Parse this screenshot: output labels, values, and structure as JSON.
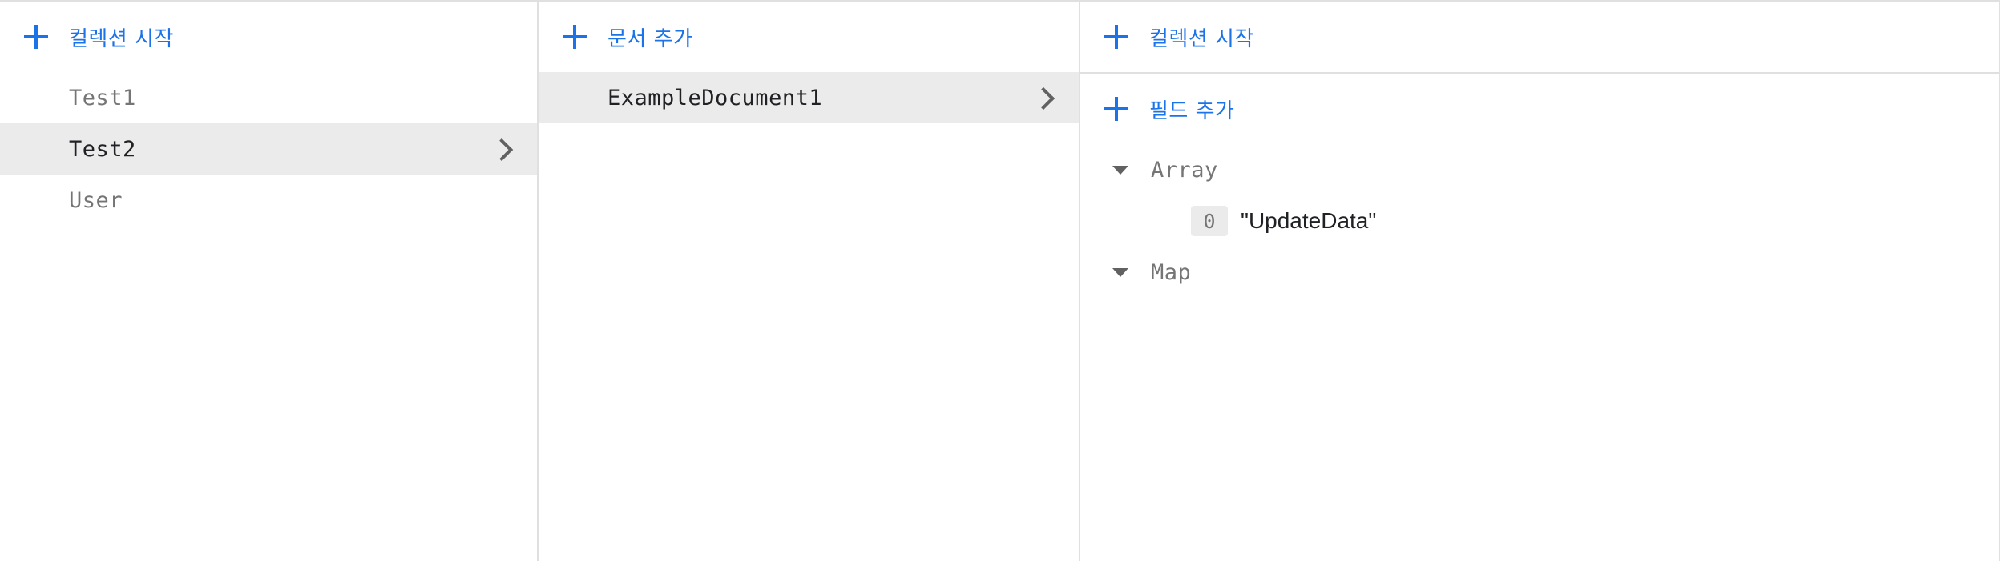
{
  "collections_panel": {
    "add_label": "컬렉션 시작",
    "items": [
      {
        "label": "Test1",
        "selected": false
      },
      {
        "label": "Test2",
        "selected": true
      },
      {
        "label": "User",
        "selected": false
      }
    ]
  },
  "documents_panel": {
    "add_label": "문서 추가",
    "items": [
      {
        "label": "ExampleDocument1",
        "selected": true
      }
    ]
  },
  "detail_panel": {
    "add_collection_label": "컬렉션 시작",
    "add_field_label": "필드 추가",
    "fields": [
      {
        "name": "Array",
        "expanded": true,
        "items": [
          {
            "index": "0",
            "value": "\"UpdateData\""
          }
        ]
      },
      {
        "name": "Map",
        "expanded": true
      }
    ]
  },
  "colors": {
    "accent": "#1a73e8",
    "selected_bg": "#ebebeb",
    "border": "#e0e0e0",
    "muted_text": "#757575",
    "text": "#202124"
  },
  "icons": {
    "add": "plus-icon",
    "open": "chevron-right-icon",
    "expand": "triangle-down-icon"
  }
}
